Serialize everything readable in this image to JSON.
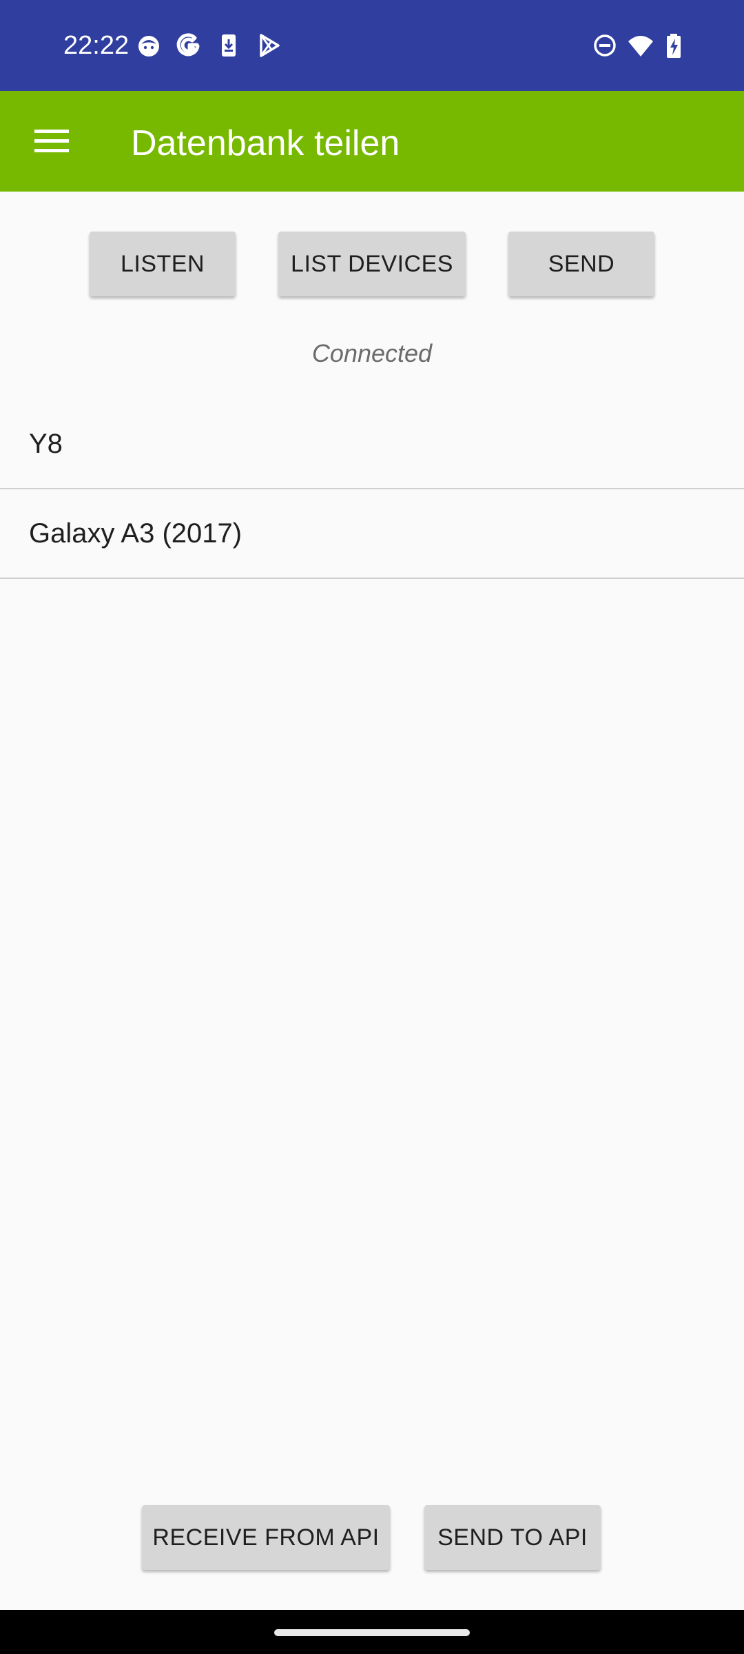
{
  "status_bar": {
    "time": "22:22",
    "left_icons": [
      "notification-face-icon",
      "google-g-icon",
      "download-phone-icon",
      "play-store-icon"
    ],
    "right_icons": [
      "do-not-disturb-icon",
      "wifi-icon",
      "battery-charging-icon"
    ],
    "background": "#303f9f"
  },
  "app_bar": {
    "title": "Datenbank teilen",
    "menu_icon": "hamburger-menu-icon",
    "background": "#76b900"
  },
  "toolbar": {
    "listen_label": "LISTEN",
    "list_devices_label": "LIST DEVICES",
    "send_label": "SEND"
  },
  "connection_status": "Connected",
  "devices": [
    {
      "label": "Y8"
    },
    {
      "label": "Galaxy A3 (2017)"
    }
  ],
  "api_actions": {
    "receive_label": "RECEIVE FROM API",
    "send_label": "SEND TO API"
  }
}
